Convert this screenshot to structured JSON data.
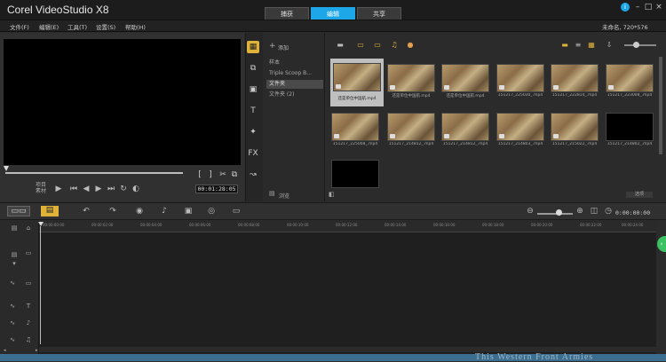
{
  "app": {
    "title": "Corel VideoStudio X8"
  },
  "tabs": [
    {
      "label": "捕获"
    },
    {
      "label": "编辑"
    },
    {
      "label": "共享"
    }
  ],
  "menu": [
    {
      "label": "文件(F)"
    },
    {
      "label": "编辑(E)"
    },
    {
      "label": "工具(T)"
    },
    {
      "label": "设置(S)"
    },
    {
      "label": "帮助(H)"
    }
  ],
  "project_info": "未命名, 720*576",
  "player": {
    "mode_labels": [
      "项目",
      "素材"
    ],
    "timecode": "00:01:28:05"
  },
  "library": {
    "add_label": "添加",
    "folders": [
      {
        "label": "样本"
      },
      {
        "label": "Triple Scoop B..."
      },
      {
        "label": "文件夹"
      },
      {
        "label": "文件夹 (2)"
      }
    ],
    "browse_label": "浏览",
    "thumbnails": [
      {
        "label": "还是单位中国航.mp4"
      },
      {
        "label": "还是单位中国航.mp4"
      },
      {
        "label": "还是单位中国航.mp4"
      },
      {
        "label": "151217_225030_.mp4"
      },
      {
        "label": "151217_222814_.mp4"
      },
      {
        "label": "151217_223008_.mp4"
      },
      {
        "label": "151217_225008_.mp4"
      },
      {
        "label": "151217_214812_.mp4"
      },
      {
        "label": "151217_214812_.mp4"
      },
      {
        "label": "151217_214803_.mp4"
      },
      {
        "label": "151217_215022_.mp4"
      },
      {
        "label": "151217_214802_.mp4"
      },
      {
        "label": ""
      }
    ],
    "bottom_button": "选项"
  },
  "timeline": {
    "timecode": "0:00:00:00",
    "ruler": [
      "00:00:00:00",
      "00:00:02:00",
      "00:00:04:00",
      "00:00:06:00",
      "00:00:08:00",
      "00:00:10:00",
      "00:00:12:00",
      "00:00:14:00",
      "00:00:16:00",
      "00:00:18:00",
      "00:00:20:00",
      "00:00:22:00",
      "00:00:24:00"
    ]
  },
  "taskbar": {
    "text": "This Western Front Armies"
  }
}
